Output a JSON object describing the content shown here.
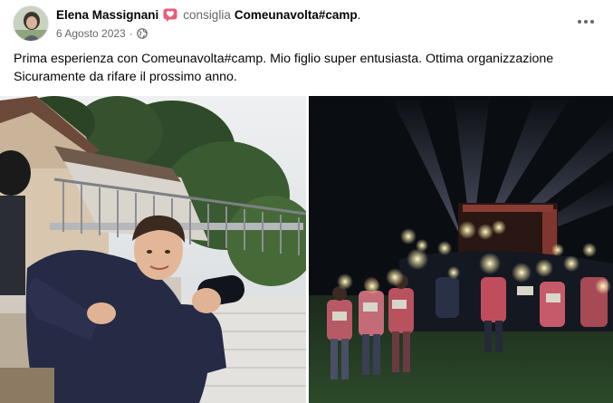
{
  "post": {
    "author": "Elena Massignani",
    "recommend_verb": "consiglia",
    "page_name": "Comeunavolta#camp",
    "page_name_suffix": ".",
    "date": "6 Agosto 2023",
    "date_separator": "·",
    "privacy_icon": "globe-icon",
    "text_line_1": "Prima esperienza con Comeunavolta#camp. Mio figlio super entusiasta. Ottima organizzazione",
    "text_line_2": " Sicuramente da rifare il prossimo anno."
  },
  "icons": {
    "recommend": "recommend-icon",
    "more": "more-options-icon"
  },
  "colors": {
    "primary_text": "#050505",
    "secondary_text": "#65676b",
    "recommend_icon": "#e85d7a",
    "night_sky": "#0a0d12"
  }
}
